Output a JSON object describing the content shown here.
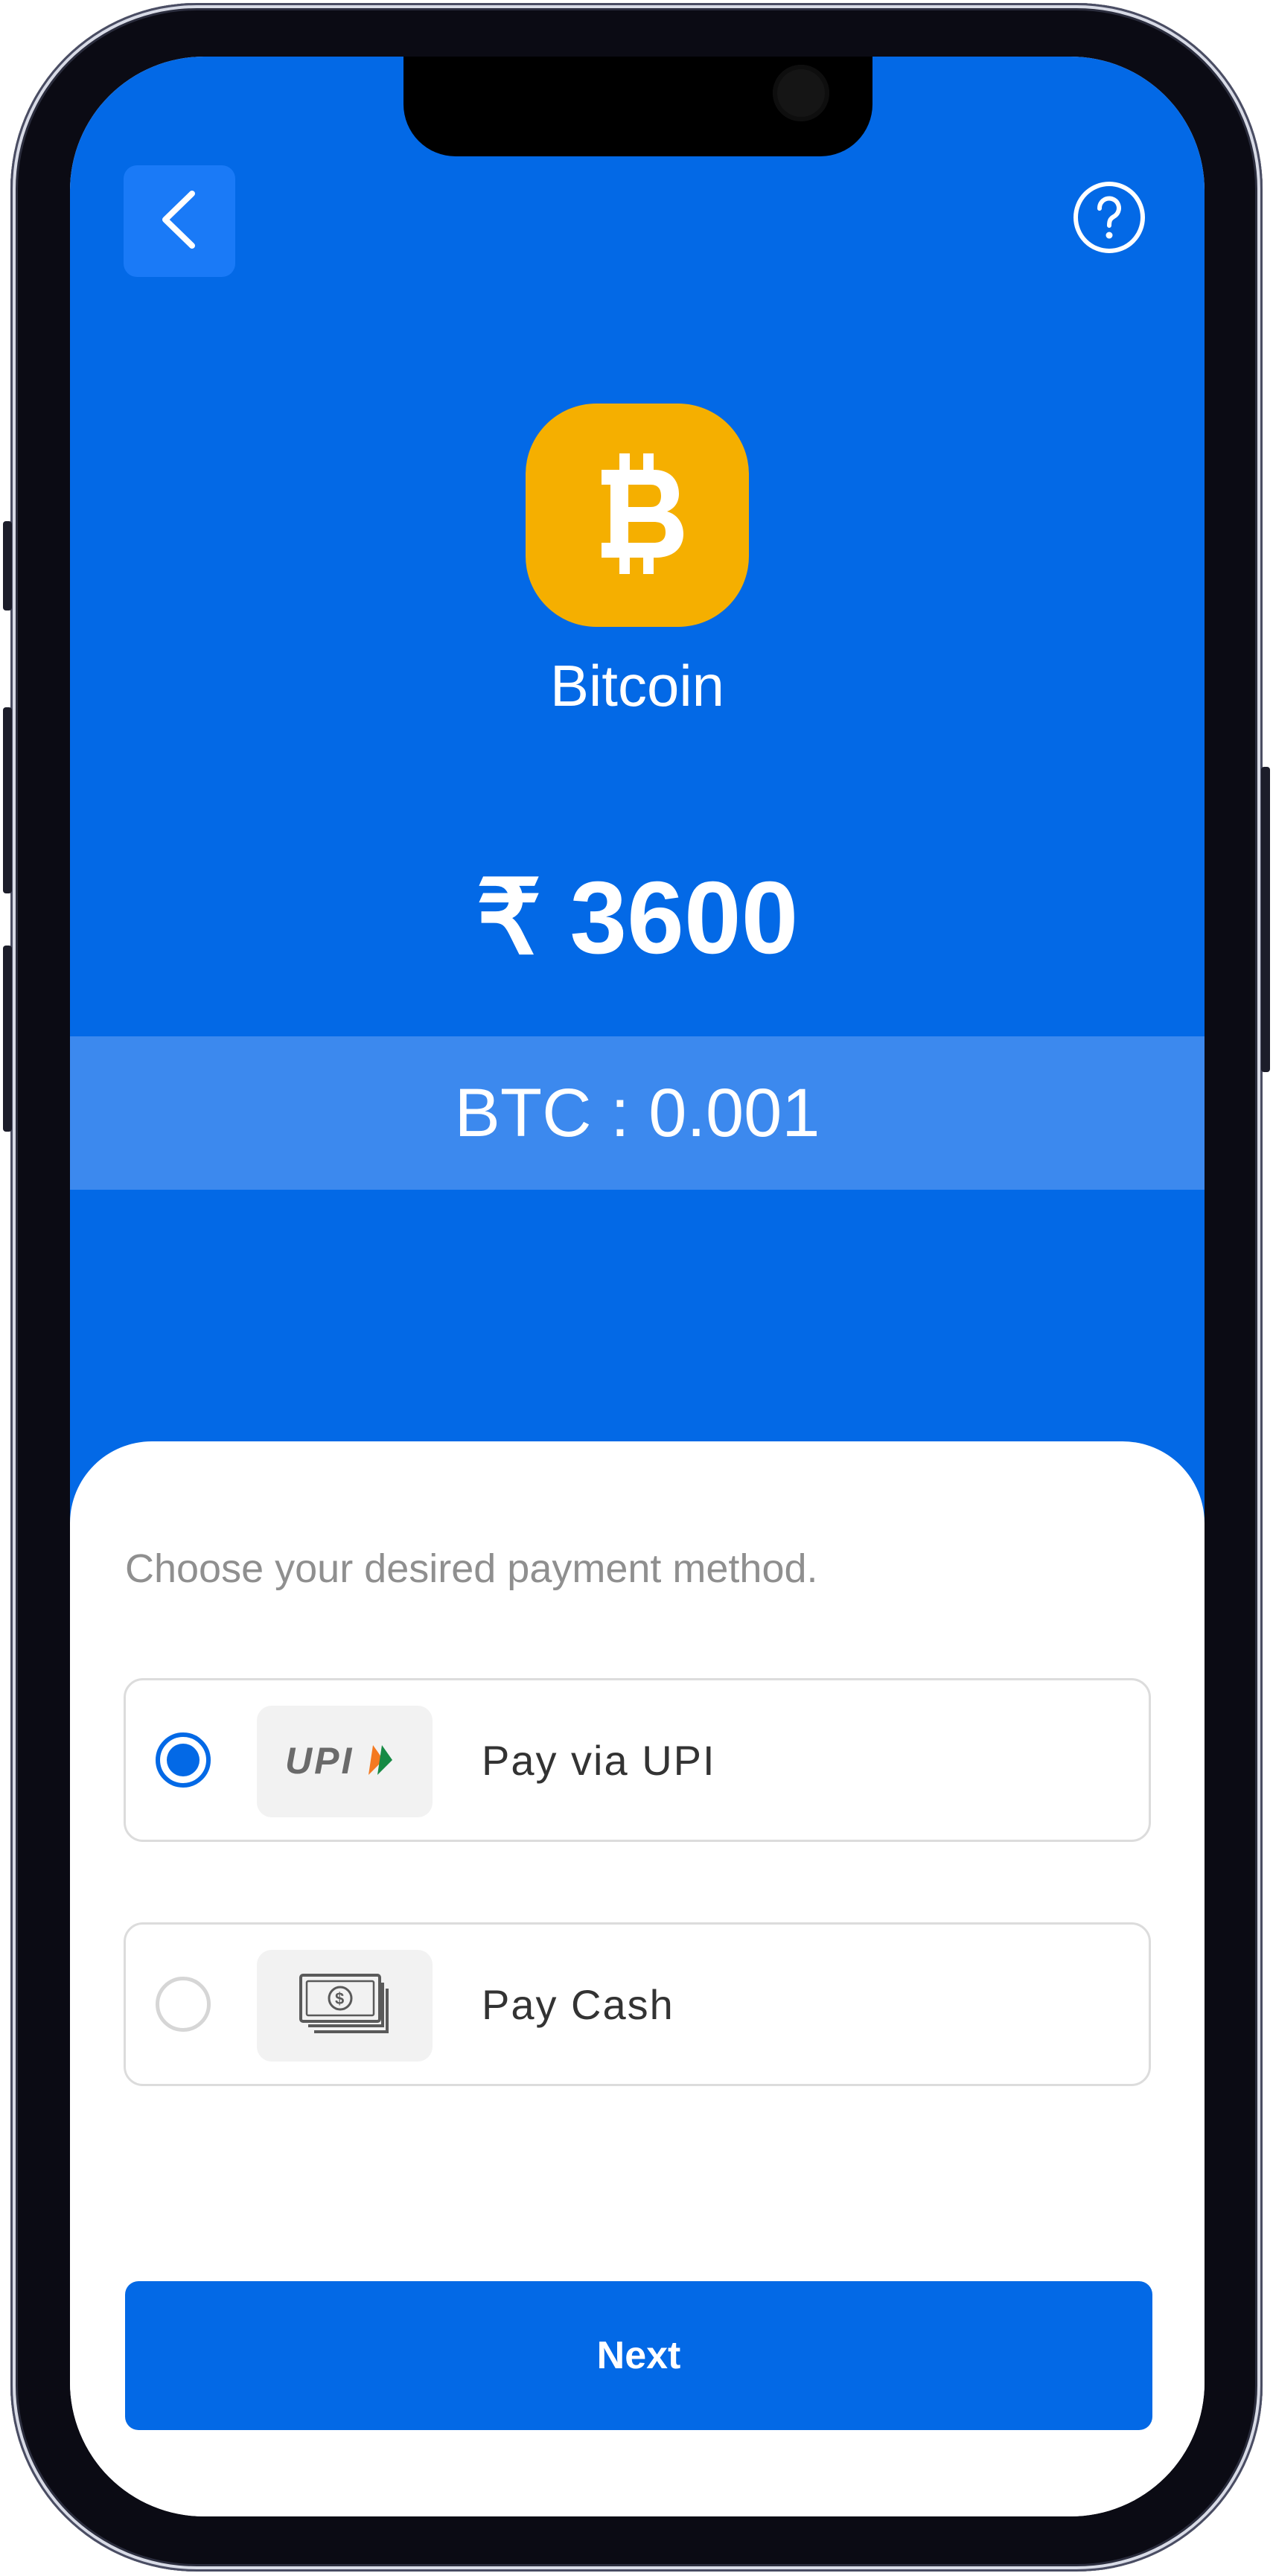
{
  "header": {
    "back_icon": "chevron-left-icon",
    "help_icon": "question-circle-icon"
  },
  "asset": {
    "icon": "bitcoin-icon",
    "icon_bg_color": "#F5AF00",
    "name": "Bitcoin"
  },
  "price": {
    "currency_symbol": "₹",
    "amount": "3600"
  },
  "conversion": {
    "label": "BTC : 0.001"
  },
  "payment": {
    "prompt": "Choose your desired payment method.",
    "options": [
      {
        "label": "Pay via UPI",
        "icon": "upi-logo-icon",
        "selected": true
      },
      {
        "label": "Pay Cash",
        "icon": "cash-icon",
        "selected": false
      }
    ]
  },
  "actions": {
    "next_label": "Next"
  },
  "colors": {
    "primary": "#0369E6",
    "band": "#3C89EE",
    "coin": "#F5AF00"
  }
}
